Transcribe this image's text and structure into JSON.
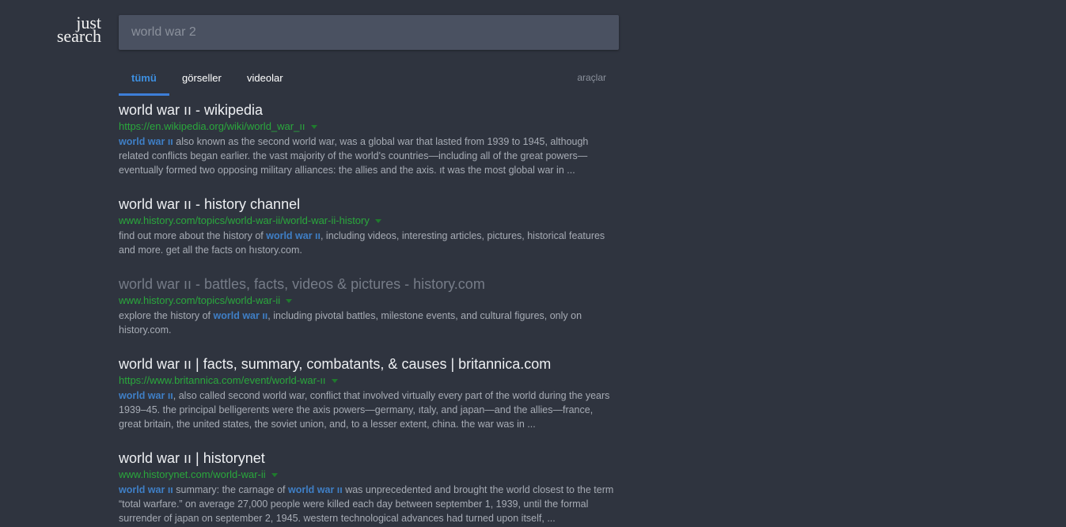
{
  "logo": {
    "line1": "just",
    "line2": "search"
  },
  "search": {
    "value": "world war 2"
  },
  "tabs": [
    {
      "label": "tümü",
      "active": true
    },
    {
      "label": "görseller",
      "active": false
    },
    {
      "label": "videolar",
      "active": false
    }
  ],
  "tools_label": "araçlar",
  "colors": {
    "background": "#2f343f",
    "search_box": "#4a5161",
    "accent": "#3d8fe0",
    "url_green": "#2aa83c",
    "highlight_blue": "#3f7fc6"
  },
  "results": [
    {
      "title": "world war ıı - wikipedia",
      "url": "https://en.wikipedia.org/wiki/world_war_ıı",
      "visited": false,
      "snippet": [
        {
          "hl": true,
          "text": "world war ıı"
        },
        {
          "hl": false,
          "text": " also known as the second world war, was a global war that lasted from 1939 to 1945, although related conflicts began earlier. the vast majority of the world's countries—including all of the great powers—eventually formed two opposing military alliances: the allies and the axis. ıt was the most global war in ..."
        }
      ]
    },
    {
      "title": "world war ıı - history channel",
      "url": "www.history.com/topics/world-war-ii/world-war-ii-history",
      "visited": false,
      "snippet": [
        {
          "hl": false,
          "text": "find out more about the history of "
        },
        {
          "hl": true,
          "text": "world war ıı"
        },
        {
          "hl": false,
          "text": ", including videos, interesting articles, pictures, historical features and more. get all the facts on hıstory.com."
        }
      ]
    },
    {
      "title": "world war ıı - battles, facts, videos & pictures - history.com",
      "url": "www.history.com/topics/world-war-ii",
      "visited": true,
      "snippet": [
        {
          "hl": false,
          "text": "explore the history of "
        },
        {
          "hl": true,
          "text": "world war ıı"
        },
        {
          "hl": false,
          "text": ", including pivotal battles, milestone events, and cultural figures, only on history.com."
        }
      ]
    },
    {
      "title": "world war ıı | facts, summary, combatants, & causes | britannica.com",
      "url": "https://www.britannica.com/event/world-war-ıı",
      "visited": false,
      "snippet": [
        {
          "hl": true,
          "text": "world war ıı"
        },
        {
          "hl": false,
          "text": ", also called second world war, conflict that involved virtually every part of the world during the years 1939–45. the principal belligerents were the axis powers—germany, ıtaly, and japan—and the allies—france, great britain, the united states, the soviet union, and, to a lesser extent, china. the war was in ..."
        }
      ]
    },
    {
      "title": "world war ıı | historynet",
      "url": "www.historynet.com/world-war-ii",
      "visited": false,
      "snippet": [
        {
          "hl": true,
          "text": "world war ıı"
        },
        {
          "hl": false,
          "text": " summary: the carnage of "
        },
        {
          "hl": true,
          "text": "world war ıı"
        },
        {
          "hl": false,
          "text": " was unprecedented and brought the world closest to the term “total warfare.” on average 27,000 people were killed each day between september 1, 1939, until the formal surrender of japan on september 2, 1945. western technological advances had turned upon itself, ..."
        }
      ]
    }
  ]
}
